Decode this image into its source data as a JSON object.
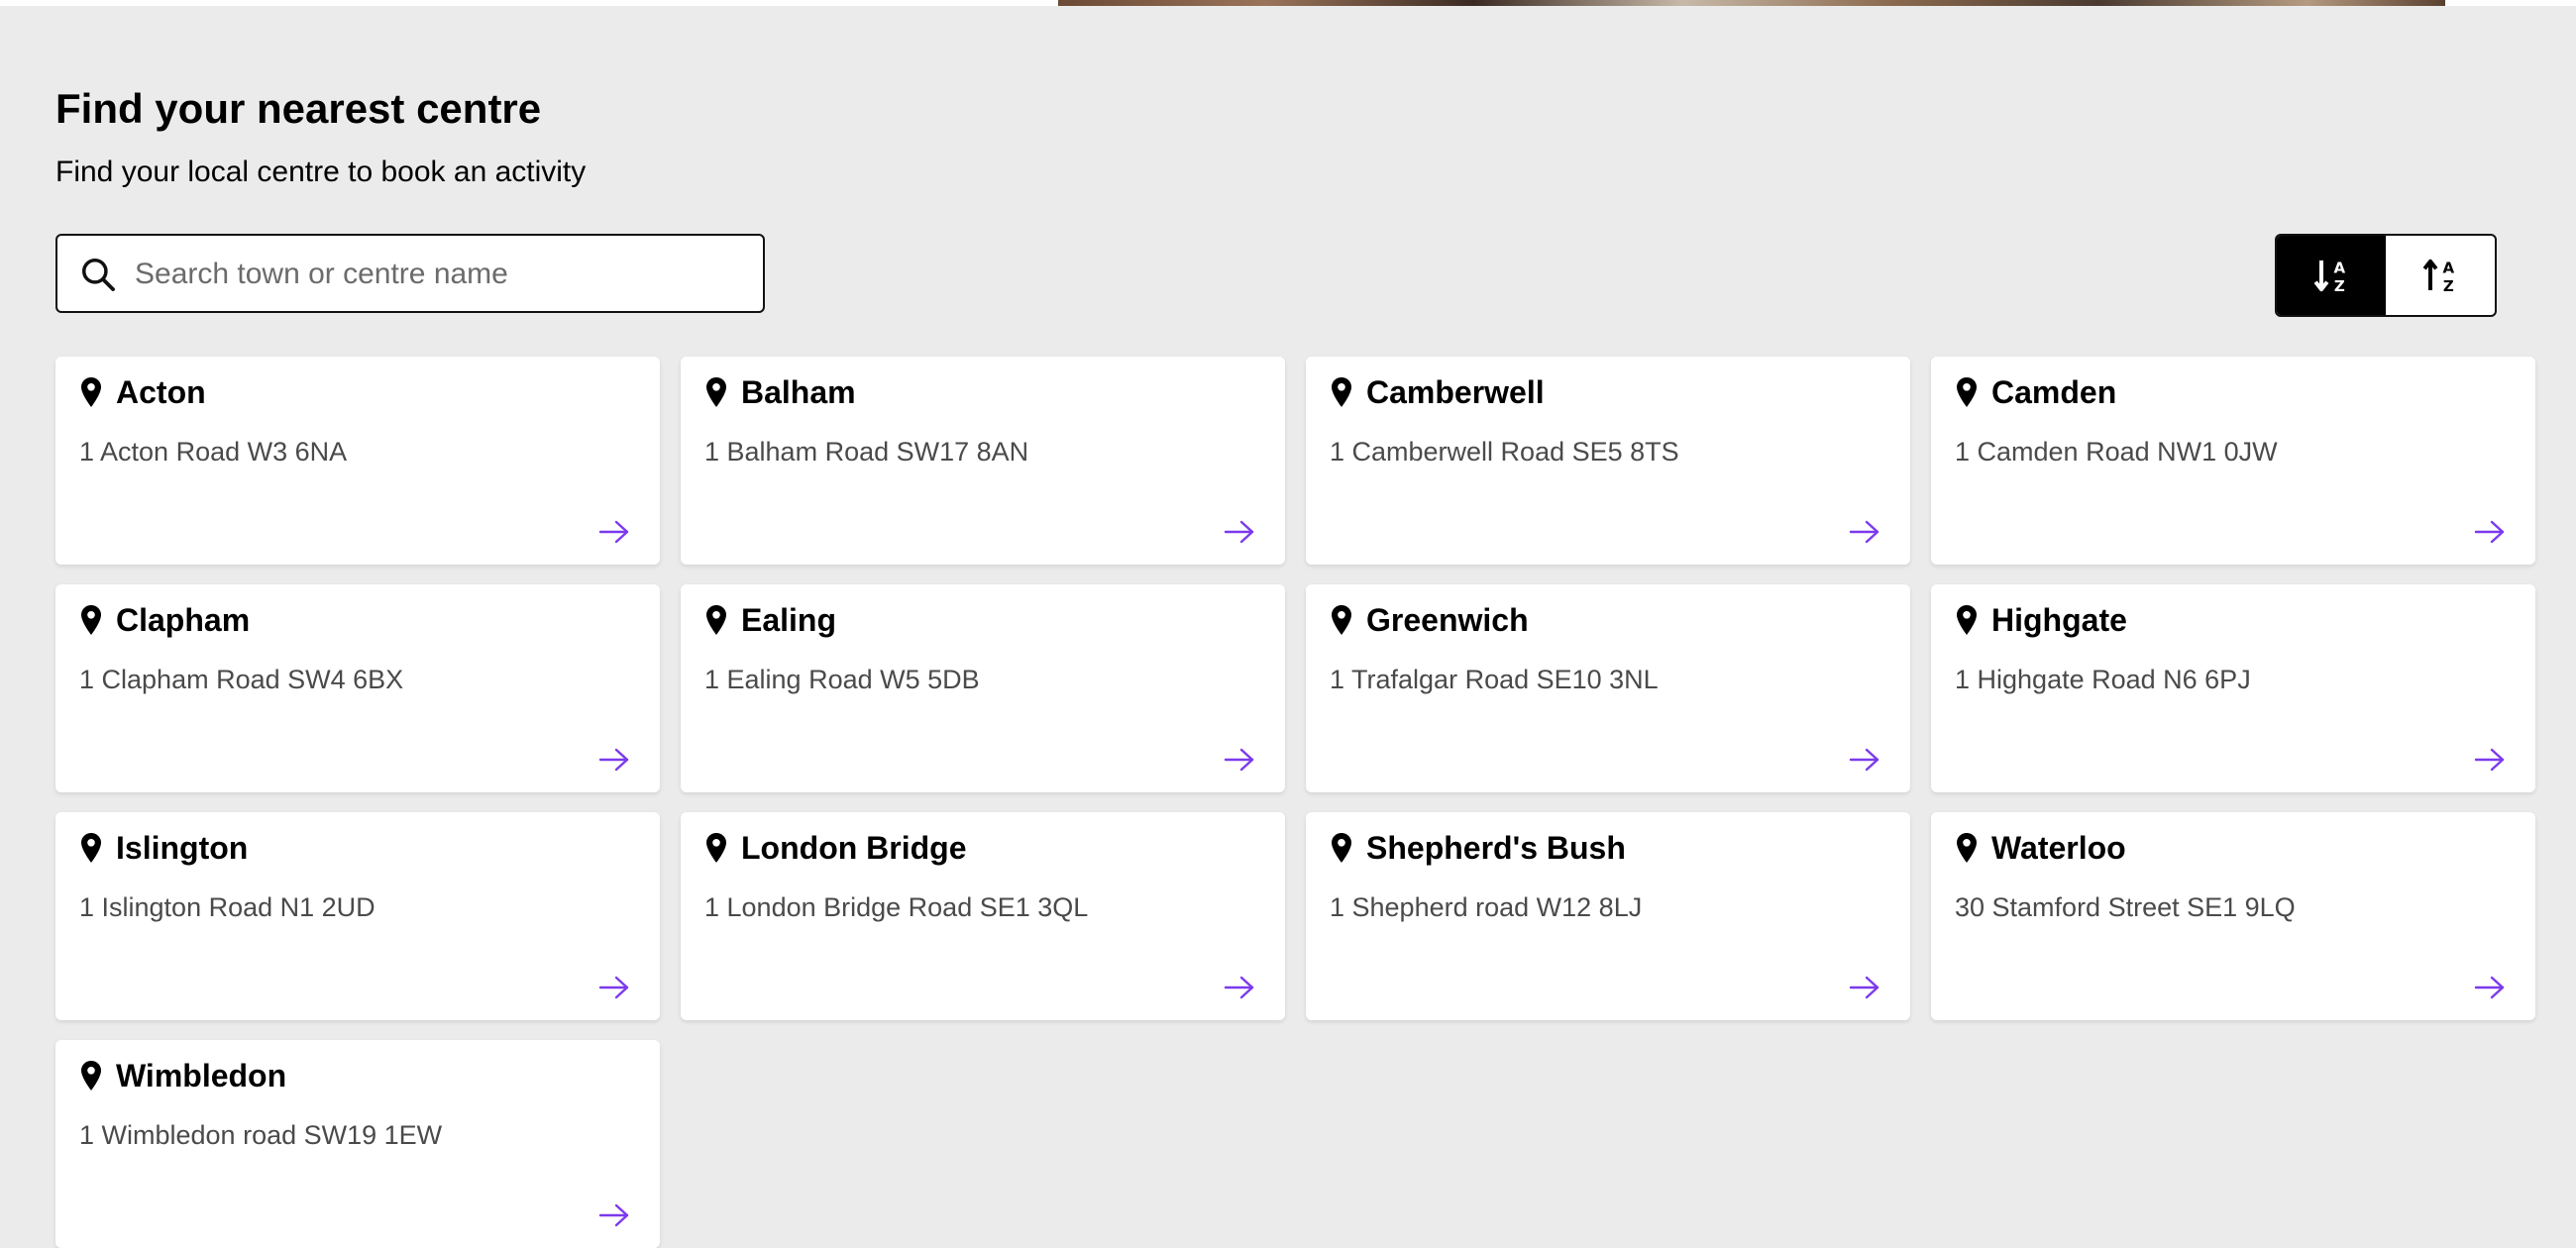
{
  "page": {
    "heading": "Find your nearest centre",
    "subheading": "Find your local centre to book an activity"
  },
  "search": {
    "placeholder": "Search town or centre name",
    "value": ""
  },
  "sort": {
    "ascending_icon": "sort-alpha-ascending-icon",
    "descending_icon": "sort-alpha-descending-icon",
    "active": "ascending"
  },
  "colors": {
    "background": "#ebebeb",
    "card": "#ffffff",
    "accent": "#7c3aed",
    "text": "#000000",
    "address_text": "#4a4a4a"
  },
  "centres": [
    {
      "name": "Acton",
      "address": "1 Acton Road W3 6NA"
    },
    {
      "name": "Balham",
      "address": "1 Balham Road SW17 8AN"
    },
    {
      "name": "Camberwell",
      "address": "1 Camberwell Road SE5 8TS"
    },
    {
      "name": "Camden",
      "address": "1 Camden Road NW1 0JW"
    },
    {
      "name": "Clapham",
      "address": "1 Clapham Road SW4 6BX"
    },
    {
      "name": "Ealing",
      "address": "1 Ealing Road W5 5DB"
    },
    {
      "name": "Greenwich",
      "address": "1 Trafalgar Road SE10 3NL"
    },
    {
      "name": "Highgate",
      "address": "1 Highgate Road N6 6PJ"
    },
    {
      "name": "Islington",
      "address": "1 Islington Road N1 2UD"
    },
    {
      "name": "London Bridge",
      "address": "1 London Bridge Road SE1 3QL"
    },
    {
      "name": "Shepherd's Bush",
      "address": "1 Shepherd road W12 8LJ"
    },
    {
      "name": "Waterloo",
      "address": "30 Stamford Street SE1 9LQ"
    },
    {
      "name": "Wimbledon",
      "address": "1 Wimbledon road SW19 1EW"
    }
  ]
}
